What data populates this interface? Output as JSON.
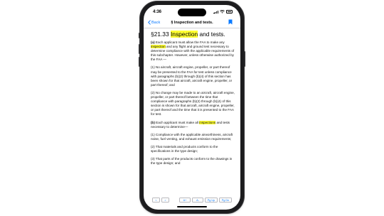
{
  "status_bar": {
    "time": "4:36"
  },
  "nav": {
    "back_label": "Back",
    "title": "§ Inspection and tests."
  },
  "heading": {
    "section": "§21.33 ",
    "highlight": "Inspection",
    "rest": " and tests."
  },
  "paragraphs": {
    "p1_label": "(a)",
    "p1_pre": " Each applicant must allow the FAA to make any ",
    "p1_highlight": "inspection",
    "p1_post": " and any flight and ground test necessary to determine compliance with the applicable requirements of this subchapter. However, unless otherwise authorized by the FAA —",
    "p2": "(1) No aircraft, aircraft engine, propeller, or part thereof may be presented to the FAA for test unless compliance with paragraphs (b)(2) through (b)(4) of this section has been shown for that aircraft, aircraft engine, propeller, or part thereof; and",
    "p3": "(2) No change may be made to an aircraft, aircraft engine, propeller, or part thereof between the time that compliance with paragraphs (b)(2) through (b)(4) of this section is shown for that aircraft, aircraft engine, propeller, or part thereof and the time that it is presented to the FAA for test.",
    "p4_label": "(b)",
    "p4_pre": " Each applicant must make all ",
    "p4_highlight": "inspections",
    "p4_post": " and tests necessary to determine—",
    "p5": "(1) Compliance with the applicable airworthiness, aircraft noise, fuel venting, and exhaust emission requirements;",
    "p6": "(2) That materials and products conform to the specifications in the type design;",
    "p7": "(3) That parts of the products conform to the drawings in the type design; and"
  },
  "toolbar": {
    "prev": "<",
    "next": ">",
    "font_up": "A+",
    "font_down": "A-",
    "page_up": "Pg Up",
    "page_down": "Pg Dn"
  },
  "colors": {
    "accent": "#0a7aff",
    "highlight": "#ffff33",
    "frame": "#1c1c1e"
  },
  "icons": [
    "back-chevron-icon",
    "bookmark-icon",
    "signal-icon",
    "wifi-icon",
    "battery-icon"
  ]
}
